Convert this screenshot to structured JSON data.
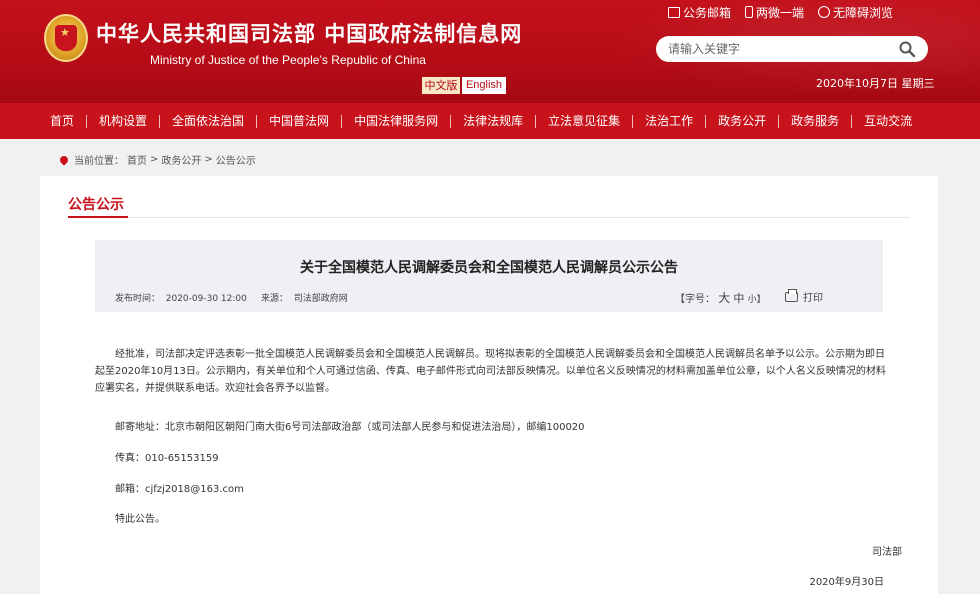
{
  "header": {
    "title": "中华人民共和国司法部  中国政府法制信息网",
    "subtitle": "Ministry of Justice of the People’s Republic of China",
    "lang_cn": "中文版",
    "lang_en": "English",
    "top_links": [
      "公务邮箱",
      "两微一端",
      "无障碍浏览"
    ],
    "search_placeholder": "请输入关键字",
    "date": "2020年10月7日 星期三"
  },
  "nav": {
    "items": [
      "首页",
      "机构设置",
      "全面依法治国",
      "中国普法网",
      "中国法律服务网",
      "法律法规库",
      "立法意见征集",
      "法治工作",
      "政务公开",
      "政务服务",
      "互动交流"
    ]
  },
  "breadcrumb": {
    "label": "当前位置：",
    "items": [
      "首页",
      "政务公开",
      "公告公示"
    ],
    "sep": ">"
  },
  "section": {
    "title": "公告公示"
  },
  "article": {
    "title": "关于全国模范人民调解委员会和全国模范人民调解员公示公告",
    "pub_label": "发布时间：",
    "pub_time": "2020-09-30 12:00",
    "src_label": "来源：",
    "source": "司法部政府网",
    "fontsize_label": "【字号：",
    "font_big": "大",
    "font_mid": "中",
    "font_small": "小】",
    "print": "打印",
    "paragraph": "经批准，司法部决定评选表彰一批全国模范人民调解委员会和全国模范人民调解员。现将拟表彰的全国模范人民调解委员会和全国模范人民调解员名单予以公示。公示期为即日起至2020年10月13日。公示期内，有关单位和个人可通过信函、传真、电子邮件形式向司法部反映情况。以单位名义反映情况的材料需加盖单位公章，以个人名义反映情况的材料应署实名，并提供联系电话。欢迎社会各界予以监督。",
    "address": "邮寄地址：北京市朝阳区朝阳门南大街6号司法部政治部（或司法部人民参与和促进法治局），邮编100020",
    "fax": "传真：010-65153159",
    "email": "邮箱：cjfzj2018@163.com",
    "closing": "特此公告。",
    "signature": "司法部",
    "sign_date": "2020年9月30日"
  },
  "colors": {
    "brand_red": "#c8131d",
    "header_red": "#b50c16"
  }
}
